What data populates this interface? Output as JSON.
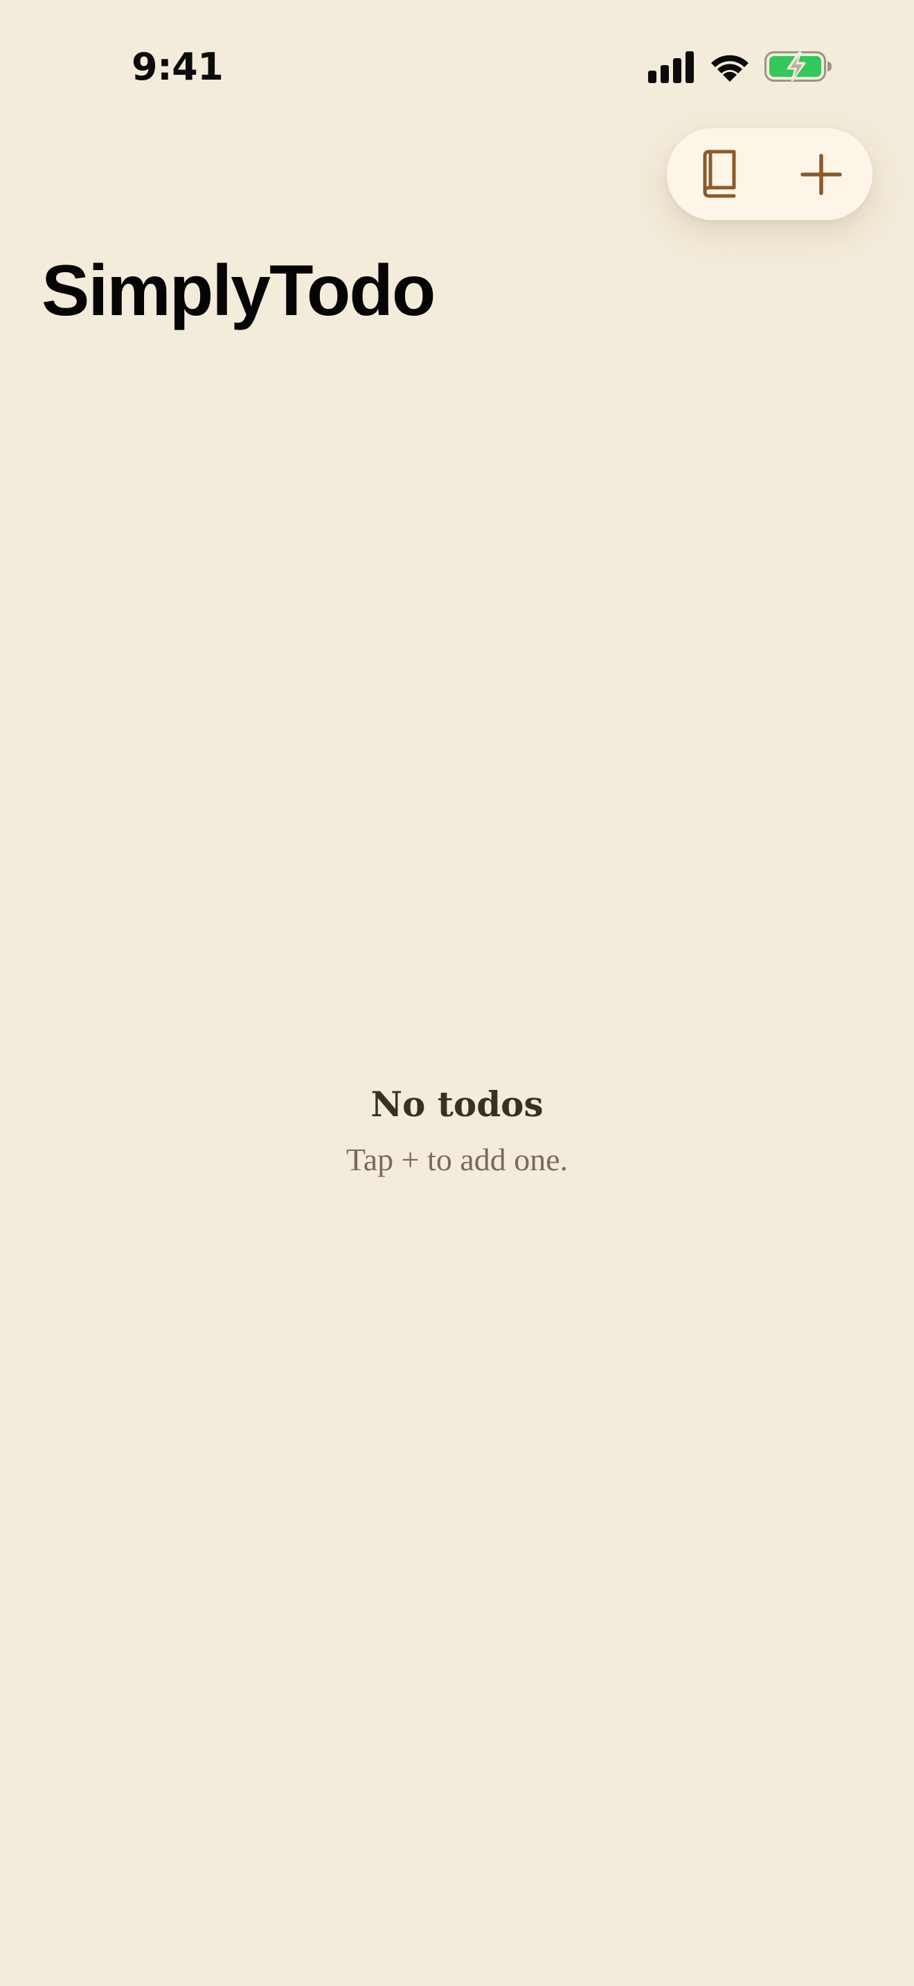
{
  "status_bar": {
    "time": "9:41",
    "signal_icon": "cellular-signal-icon",
    "wifi_icon": "wifi-icon",
    "battery_icon": "battery-charging-icon",
    "battery_color": "#34c759"
  },
  "toolbar": {
    "book_icon": "book-icon",
    "add_icon": "plus-icon",
    "accent_color": "#8b5a2b"
  },
  "header": {
    "title": "SimplyTodo"
  },
  "empty_state": {
    "title": "No todos",
    "subtitle": "Tap + to add one."
  },
  "theme": {
    "background": "#f4ecdb",
    "pill_background": "#fdf6e8"
  }
}
